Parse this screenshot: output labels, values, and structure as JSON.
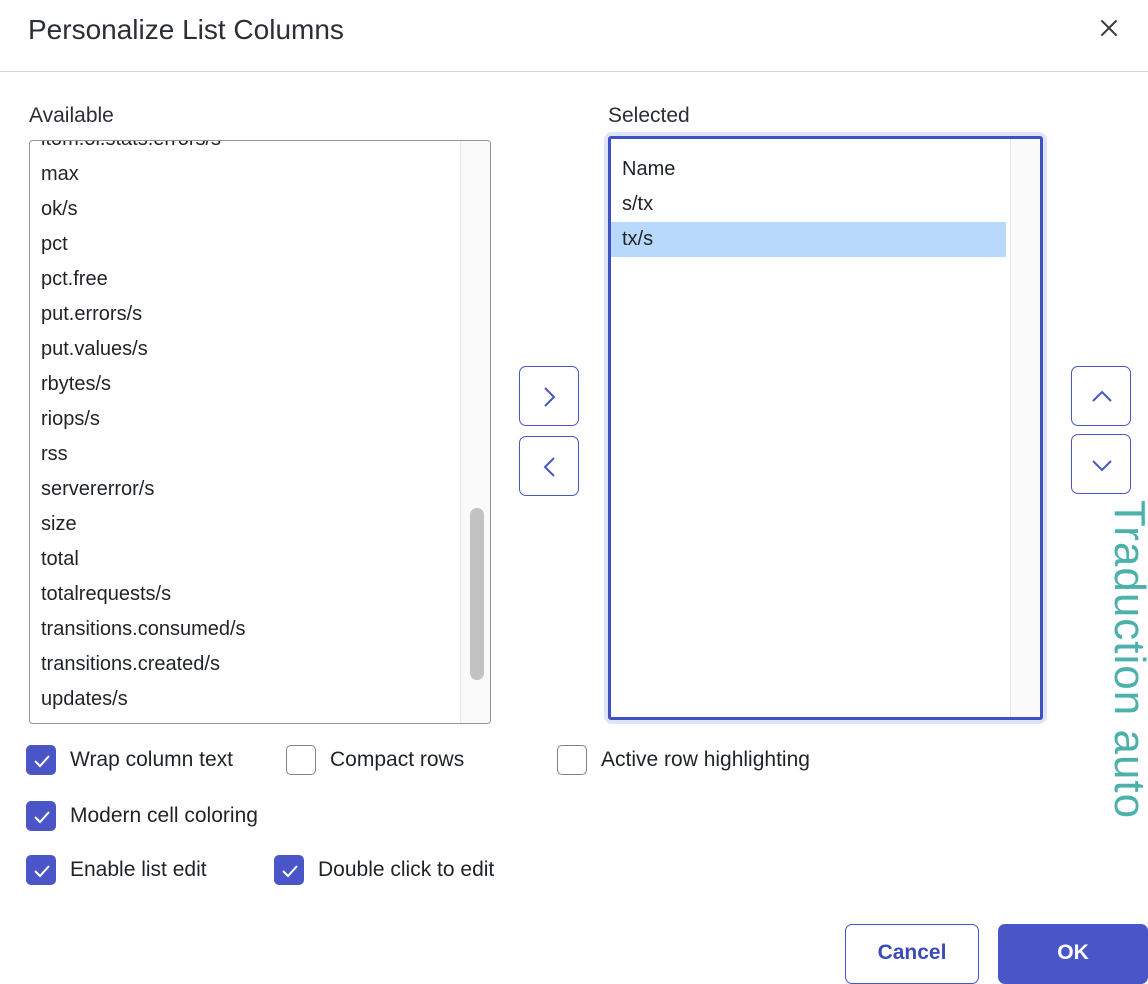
{
  "dialog": {
    "title": "Personalize List Columns",
    "close_icon": "close-icon"
  },
  "available": {
    "label": "Available",
    "items": [
      "itom.oi.stats.errors/s",
      "max",
      "ok/s",
      "pct",
      "pct.free",
      "put.errors/s",
      "put.values/s",
      "rbytes/s",
      "riops/s",
      "rss",
      "servererror/s",
      "size",
      "total",
      "totalrequests/s",
      "transitions.consumed/s",
      "transitions.created/s",
      "updates/s"
    ]
  },
  "selected": {
    "label": "Selected",
    "items": [
      "Name",
      "s/tx",
      "tx/s"
    ],
    "highlighted_item": "tx/s"
  },
  "move_buttons": {
    "add_icon": "chevron-right-icon",
    "remove_icon": "chevron-left-icon",
    "up_icon": "chevron-up-icon",
    "down_icon": "chevron-down-icon"
  },
  "options": {
    "wrap_column_text": {
      "label": "Wrap column text",
      "checked": true
    },
    "compact_rows": {
      "label": "Compact rows",
      "checked": false
    },
    "active_row_highlighting": {
      "label": "Active row highlighting",
      "checked": false
    },
    "modern_cell_coloring": {
      "label": "Modern cell coloring",
      "checked": true
    },
    "enable_list_edit": {
      "label": "Enable list edit",
      "checked": true
    },
    "double_click_to_edit": {
      "label": "Double click to edit",
      "checked": true
    }
  },
  "footer": {
    "cancel_label": "Cancel",
    "ok_label": "OK"
  },
  "watermark": {
    "text": "Traduction auto"
  },
  "colors": {
    "accent": "#4a56c7",
    "selection_highlight": "#b8d8fc",
    "watermark": "#4cb1ab"
  }
}
